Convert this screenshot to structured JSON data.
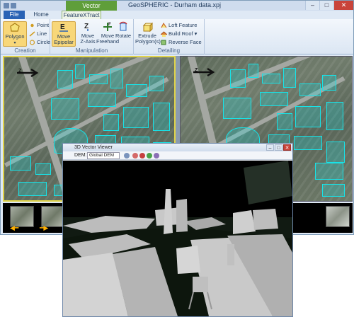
{
  "window": {
    "title": "GeoSPHERIC - Durham data.xpj",
    "context_tab": "Vector",
    "controls": {
      "minimize": "–",
      "maximize": "□",
      "close": "✕"
    }
  },
  "tabs": [
    {
      "label": "File"
    },
    {
      "label": "Home"
    },
    {
      "label": "FeatureXTract"
    }
  ],
  "ribbon": {
    "creation": {
      "label": "Creation",
      "polygon": "Polygon",
      "point": "Point",
      "line": "Line",
      "circle": "Circle"
    },
    "manipulation": {
      "label": "Manipulation",
      "move_epipolar_1": "Move",
      "move_epipolar_2": "Epipolar",
      "move_z_1": "Move",
      "move_z_2": "Z-Axis",
      "move_free_1": "Move",
      "move_free_2": "Freehand",
      "rotate": "Rotate"
    },
    "detailing": {
      "label": "Detailing",
      "extrude_1": "Extrude",
      "extrude_2": "Polygon(s)",
      "loft": "Loft Feature",
      "build_roof": "Build Roof ▾",
      "reverse_face": "Reverse Face"
    }
  },
  "viewer3d": {
    "title": "3D Vector Viewer",
    "dem_label": "DEM:",
    "dem_value": "Global DEM"
  },
  "colors": {
    "feature_outline": "#17e3e8",
    "active_view_border": "#e0d34a",
    "file_tab": "#2a63b5",
    "context_tab": "#5f9e3a"
  },
  "icons": [
    "polygon-icon",
    "point-icon",
    "line-icon",
    "circle-icon",
    "move-epipolar-icon",
    "move-z-axis-icon",
    "move-freehand-icon",
    "rotate-icon",
    "extrude-icon",
    "loft-icon",
    "build-roof-icon",
    "reverse-face-icon",
    "north-arrow-icon"
  ]
}
